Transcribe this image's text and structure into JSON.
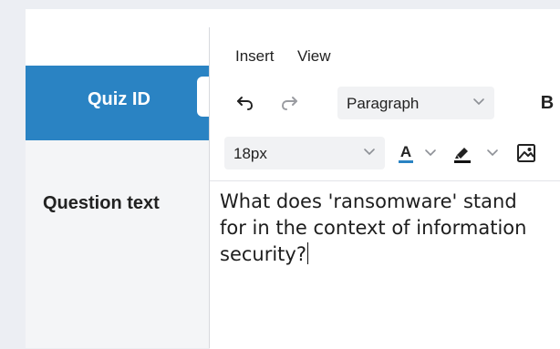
{
  "header": {
    "quiz_id_label": "Quiz ID"
  },
  "form": {
    "question_label": "Question text"
  },
  "editor": {
    "menu": [
      {
        "label": "Insert"
      },
      {
        "label": "View"
      }
    ],
    "toolbar": {
      "block_format": "Paragraph",
      "bold_label": "B",
      "font_size": "18px",
      "text_color_label": "A",
      "text_color": "#2a83c3",
      "highlight_color": "#111111"
    },
    "content": "What does 'ransomware' stand for in the context of information security?"
  },
  "icons": {
    "undo": "undo-icon",
    "redo": "redo-icon",
    "chevron": "chevron-down-icon",
    "highlighter": "highlighter-icon",
    "image": "image-icon"
  }
}
